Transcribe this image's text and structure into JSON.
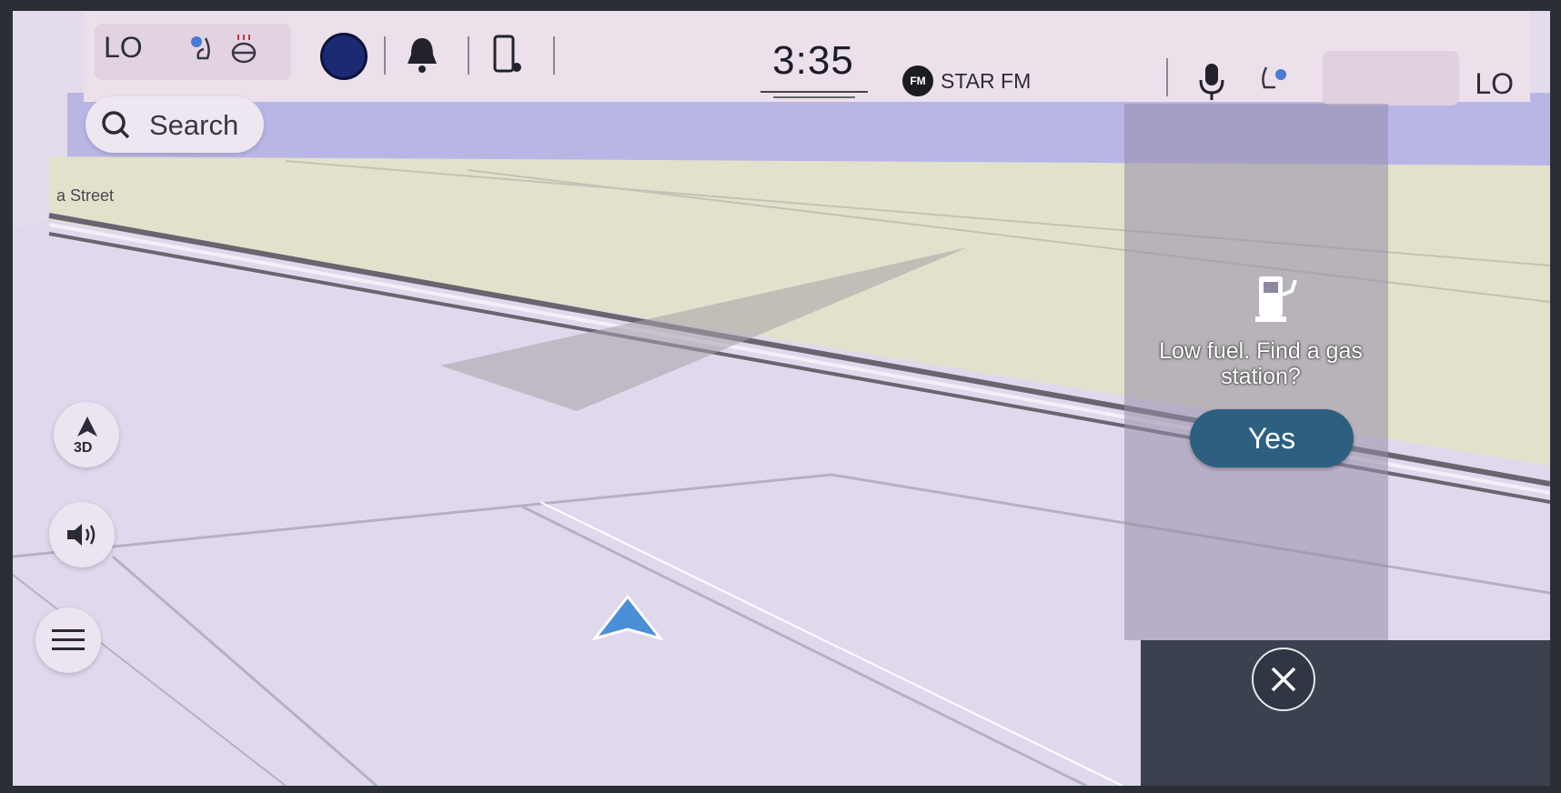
{
  "status_bar": {
    "left_temp": "LO",
    "right_temp": "LO",
    "time": "3:35",
    "radio_band": "FM",
    "radio_station": "STAR FM"
  },
  "search": {
    "label": "Search"
  },
  "map": {
    "street_label": "a Street"
  },
  "controls": {
    "view_mode_label": "3D"
  },
  "fuel_prompt": {
    "message": "Low fuel. Find a gas station?",
    "yes_label": "Yes"
  },
  "colors": {
    "yes_button": "#2d5f80",
    "nav_arrow": "#4a8fd8",
    "map_bg": "#e6dff0"
  }
}
